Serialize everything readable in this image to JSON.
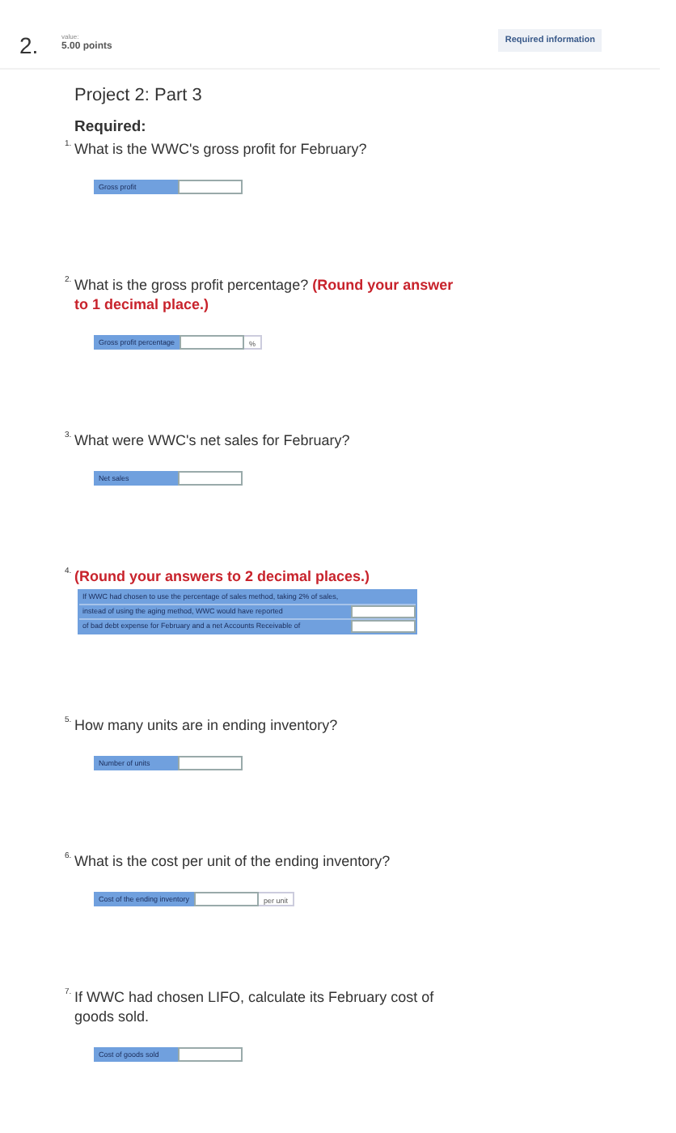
{
  "header": {
    "number": "2.",
    "value_label": "value:",
    "points": "5.00 points",
    "required_button": "Required information"
  },
  "title": "Project 2: Part 3",
  "required_label": "Required:",
  "questions": [
    {
      "kind": "field",
      "number": "1.",
      "text": "What is the WWC's gross profit for February?",
      "fields": [
        {
          "label": "Gross profit"
        }
      ]
    },
    {
      "kind": "field",
      "number": "2.",
      "text": "What is the gross profit percentage?",
      "instruction": "(Round your answer to 1 decimal place.)",
      "fields": [
        {
          "label": "Gross profit percentage",
          "unit": "%"
        }
      ]
    },
    {
      "kind": "field",
      "number": "3.",
      "text": "What were WWC's net sales for February?",
      "fields": [
        {
          "label": "Net sales"
        }
      ]
    },
    {
      "kind": "table",
      "number": "4.",
      "instruction": "(Round your answers to 2 decimal places.)",
      "rows": [
        {
          "label": "If WWC had chosen to use the percentage of sales method, taking 2% of sales,",
          "input": false
        },
        {
          "label": "instead of using the aging method, WWC would have reported",
          "input": true
        },
        {
          "label": "of bad debt expense for February and a net Accounts Receivable of",
          "input": true
        }
      ]
    },
    {
      "kind": "field",
      "number": "5.",
      "text": "How many units are in ending inventory?",
      "fields": [
        {
          "label": "Number of units"
        }
      ]
    },
    {
      "kind": "field",
      "number": "6.",
      "text": "What is the cost per unit of the ending inventory?",
      "fields": [
        {
          "label": "Cost of the ending inventory",
          "unit": "per unit"
        }
      ]
    },
    {
      "kind": "field",
      "number": "7.",
      "text": "If WWC had chosen LIFO, calculate its February cost of goods sold.",
      "fields": [
        {
          "label": "Cost of goods sold"
        }
      ]
    }
  ]
}
